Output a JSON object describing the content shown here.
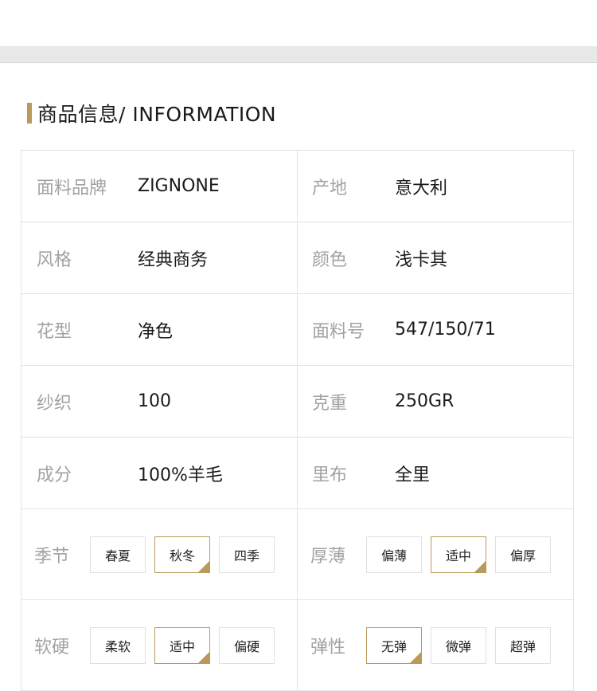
{
  "section": {
    "title": "商品信息/ INFORMATION"
  },
  "specs": {
    "fabric_brand": {
      "label": "面料品牌",
      "value": "ZIGNONE"
    },
    "origin": {
      "label": "产地",
      "value": "意大利"
    },
    "style": {
      "label": "风格",
      "value": "经典商务"
    },
    "color": {
      "label": "颜色",
      "value": "浅卡其"
    },
    "pattern": {
      "label": "花型",
      "value": "净色"
    },
    "fabric_no": {
      "label": "面料号",
      "value": "547/150/71"
    },
    "yarn": {
      "label": "纱织",
      "value": "100"
    },
    "weight": {
      "label": "克重",
      "value": "250GR"
    },
    "composition": {
      "label": "成分",
      "value": "100%羊毛"
    },
    "lining": {
      "label": "里布",
      "value": "全里"
    }
  },
  "options": {
    "season": {
      "label": "季节",
      "choices": [
        "春夏",
        "秋冬",
        "四季"
      ],
      "selected": "秋冬"
    },
    "thickness": {
      "label": "厚薄",
      "choices": [
        "偏薄",
        "适中",
        "偏厚"
      ],
      "selected": "适中"
    },
    "softness": {
      "label": "软硬",
      "choices": [
        "柔软",
        "适中",
        "偏硬"
      ],
      "selected": "适中"
    },
    "elasticity": {
      "label": "弹性",
      "choices": [
        "无弹",
        "微弹",
        "超弹"
      ],
      "selected": "无弹"
    }
  },
  "colors": {
    "accent": "#b99a5b",
    "label": "#a2a2a2",
    "border": "#e3e3e3",
    "band": "#e8e8e8"
  }
}
